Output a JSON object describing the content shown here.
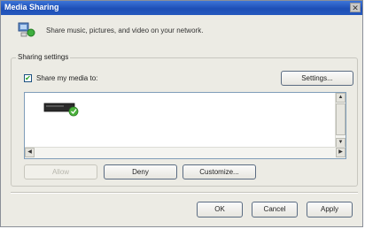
{
  "window": {
    "title": "Media Sharing"
  },
  "header": {
    "description": "Share music, pictures, and video on your network."
  },
  "sharing_settings": {
    "legend": "Sharing settings",
    "share_checkbox_label": "Share my media to:",
    "share_checked": true,
    "settings_button": "Settings..."
  },
  "device_list": {
    "items": [
      {
        "icon": "media-device-icon",
        "status": "allowed"
      }
    ]
  },
  "actions": {
    "allow": "Allow",
    "deny": "Deny",
    "customize": "Customize..."
  },
  "footer": {
    "ok": "OK",
    "cancel": "Cancel",
    "apply": "Apply"
  }
}
